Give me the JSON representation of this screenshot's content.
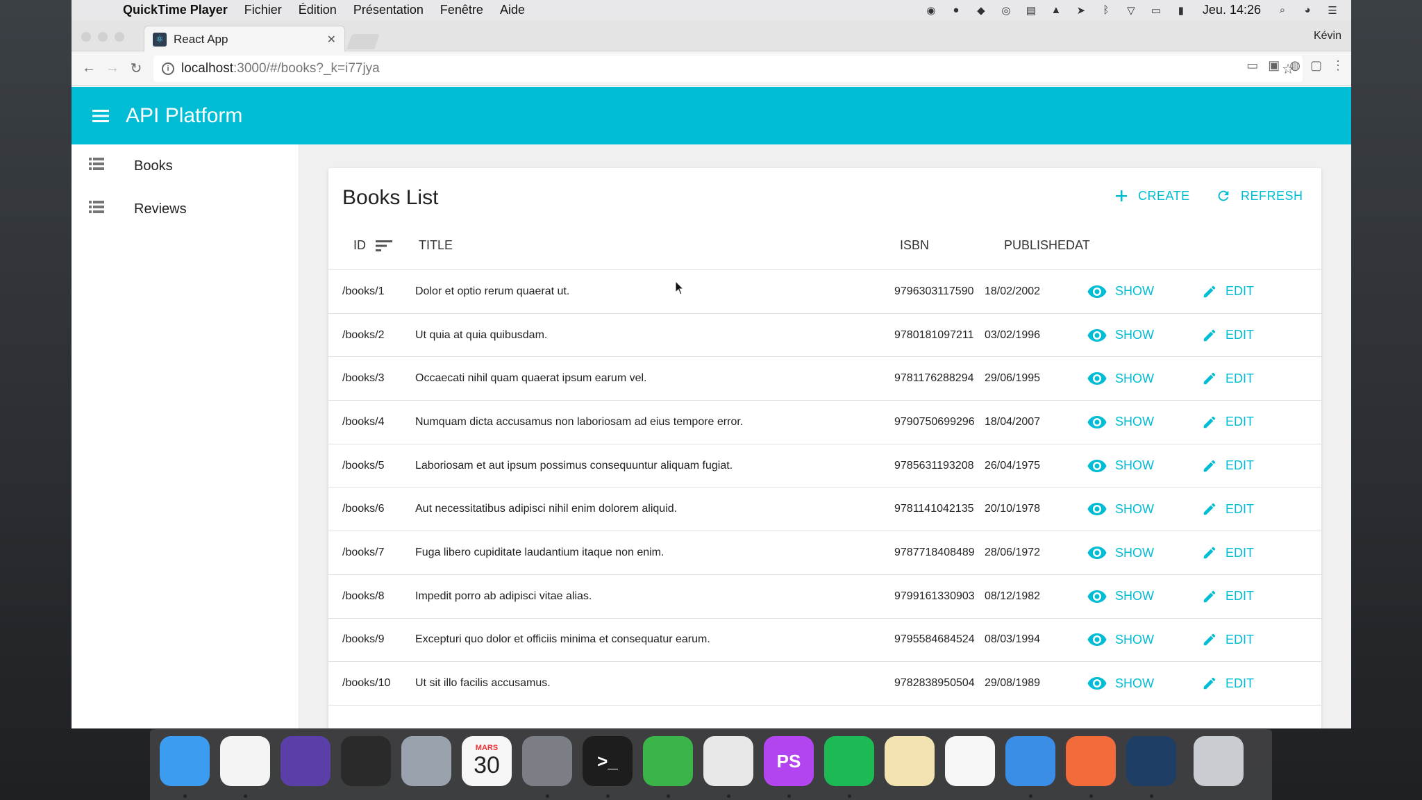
{
  "menubar": {
    "app_name": "QuickTime Player",
    "items": [
      "Fichier",
      "Édition",
      "Présentation",
      "Fenêtre",
      "Aide"
    ],
    "clock": "Jeu. 14:26"
  },
  "browser": {
    "tab_title": "React App",
    "profile": "Kévin",
    "url_host": "localhost",
    "url_path": ":3000/#/books?_k=i77jya"
  },
  "app": {
    "title": "API Platform",
    "sidebar": [
      {
        "label": "Books",
        "icon": "list-icon"
      },
      {
        "label": "Reviews",
        "icon": "list-icon"
      }
    ],
    "accent": "#00bcd4"
  },
  "list": {
    "title": "Books List",
    "create_label": "CREATE",
    "refresh_label": "REFRESH",
    "columns": {
      "id": "ID",
      "title": "TITLE",
      "isbn": "ISBN",
      "published": "PUBLISHEDAT"
    },
    "show_label": "SHOW",
    "edit_label": "EDIT",
    "rows": [
      {
        "id": "/books/1",
        "title": "Dolor et optio rerum quaerat ut.",
        "isbn": "9796303117590",
        "date": "18/02/2002"
      },
      {
        "id": "/books/2",
        "title": "Ut quia at quia quibusdam.",
        "isbn": "9780181097211",
        "date": "03/02/1996"
      },
      {
        "id": "/books/3",
        "title": "Occaecati nihil quam quaerat ipsum earum vel.",
        "isbn": "9781176288294",
        "date": "29/06/1995"
      },
      {
        "id": "/books/4",
        "title": "Numquam dicta accusamus non laboriosam ad eius tempore error.",
        "isbn": "9790750699296",
        "date": "18/04/2007"
      },
      {
        "id": "/books/5",
        "title": "Laboriosam et aut ipsum possimus consequuntur aliquam fugiat.",
        "isbn": "9785631193208",
        "date": "26/04/1975"
      },
      {
        "id": "/books/6",
        "title": "Aut necessitatibus adipisci nihil enim dolorem aliquid.",
        "isbn": "9781141042135",
        "date": "20/10/1978"
      },
      {
        "id": "/books/7",
        "title": "Fuga libero cupiditate laudantium itaque non enim.",
        "isbn": "9787718408489",
        "date": "28/06/1972"
      },
      {
        "id": "/books/8",
        "title": "Impedit porro ab adipisci vitae alias.",
        "isbn": "9799161330903",
        "date": "08/12/1982"
      },
      {
        "id": "/books/9",
        "title": "Excepturi quo dolor et officiis minima et consequatur earum.",
        "isbn": "9795584684524",
        "date": "08/03/1994"
      },
      {
        "id": "/books/10",
        "title": "Ut sit illo facilis accusamus.",
        "isbn": "9782838950504",
        "date": "29/08/1989"
      }
    ]
  },
  "dock": {
    "apps": [
      {
        "icon": "finder-icon",
        "color": "#3b9cf0"
      },
      {
        "icon": "photos-icon",
        "color": "#f4f4f4"
      },
      {
        "icon": "siri-icon",
        "color": "#5b3fa8"
      },
      {
        "icon": "photo-booth-icon",
        "color": "#2a2a2a"
      },
      {
        "icon": "launchpad-icon",
        "color": "#9aa3ad"
      },
      {
        "icon": "calendar-icon",
        "color": "#f7f7f7",
        "month": "MARS",
        "day": "30"
      },
      {
        "icon": "system-preferences-icon",
        "color": "#7b7f85"
      },
      {
        "icon": "terminal-icon",
        "color": "#1d1d1d",
        "glyph": ">_"
      },
      {
        "icon": "evernote-icon",
        "color": "#3bb54a"
      },
      {
        "icon": "chrome-icon",
        "color": "#e8e8e8"
      },
      {
        "icon": "phpstorm-icon",
        "color": "#b345f1",
        "glyph": "PS"
      },
      {
        "icon": "spotify-icon",
        "color": "#1db954"
      },
      {
        "icon": "textedit-icon",
        "color": "#f3e3b0"
      },
      {
        "icon": "app-grid-icon",
        "color": "#f7f7f7"
      },
      {
        "icon": "keynote-icon",
        "color": "#3a8ee6"
      },
      {
        "icon": "sketch-icon",
        "color": "#f26b3a"
      },
      {
        "icon": "quicktime-icon",
        "color": "#1e3e66"
      },
      {
        "icon": "trash-icon",
        "color": "#c9ccd1"
      }
    ]
  }
}
